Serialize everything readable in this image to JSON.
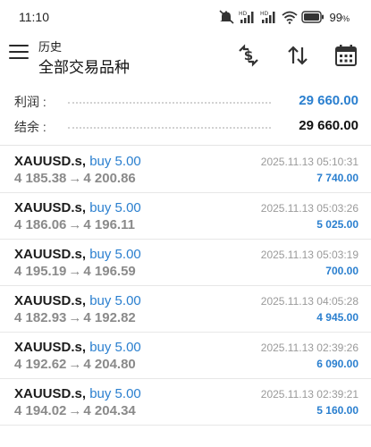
{
  "status_bar": {
    "time": "11:10",
    "battery_percent": "99",
    "battery_unit": "%"
  },
  "header": {
    "subtitle": "历史",
    "title": "全部交易品种",
    "icons": [
      "menu-icon",
      "dollar-swap-icon",
      "sort-icon",
      "calendar-icon"
    ]
  },
  "summary": {
    "profit_label": "利润 :",
    "profit_value": "29 660.00",
    "balance_label": "结余 :",
    "balance_value": "29 660.00"
  },
  "trades": [
    {
      "symbol": "XAUUSD.s",
      "side": "buy 5.00",
      "open": "4 185.38",
      "close": "4 200.86",
      "time": "2025.11.13 05:10:31",
      "profit": "7 740.00"
    },
    {
      "symbol": "XAUUSD.s",
      "side": "buy 5.00",
      "open": "4 186.06",
      "close": "4 196.11",
      "time": "2025.11.13 05:03:26",
      "profit": "5 025.00"
    },
    {
      "symbol": "XAUUSD.s",
      "side": "buy 5.00",
      "open": "4 195.19",
      "close": "4 196.59",
      "time": "2025.11.13 05:03:19",
      "profit": "700.00"
    },
    {
      "symbol": "XAUUSD.s",
      "side": "buy 5.00",
      "open": "4 182.93",
      "close": "4 192.82",
      "time": "2025.11.13 04:05:28",
      "profit": "4 945.00"
    },
    {
      "symbol": "XAUUSD.s",
      "side": "buy 5.00",
      "open": "4 192.62",
      "close": "4 204.80",
      "time": "2025.11.13 02:39:26",
      "profit": "6 090.00"
    },
    {
      "symbol": "XAUUSD.s",
      "side": "buy 5.00",
      "open": "4 194.02",
      "close": "4 204.34",
      "time": "2025.11.13 02:39:21",
      "profit": "5 160.00"
    }
  ],
  "colors": {
    "accent_blue": "#2a7fcf",
    "price_gray": "#8a8a8a"
  }
}
